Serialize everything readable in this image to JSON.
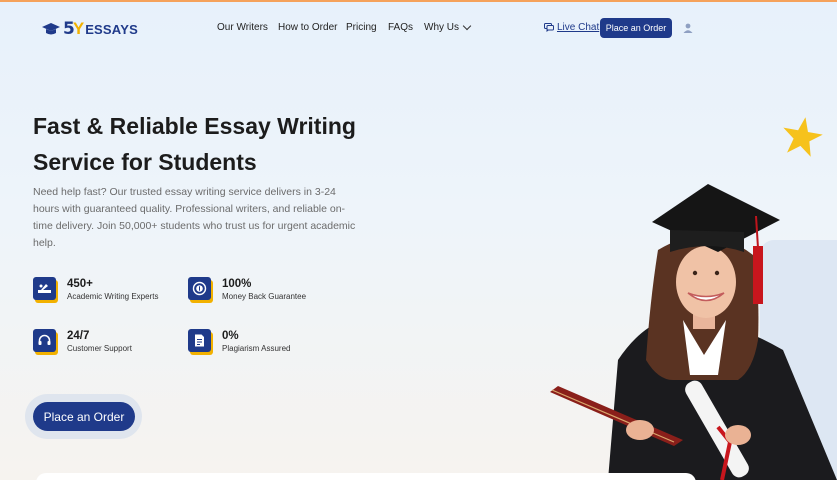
{
  "header": {
    "logo": {
      "five": "5",
      "y": "Y",
      "essays": "ESSAYS"
    },
    "nav": {
      "writers": "Our Writers",
      "how": "How to Order",
      "pricing": "Pricing",
      "faqs": "FAQs",
      "why": "Why Us"
    },
    "live_chat": "Live Chat",
    "order_button": "Place an Order"
  },
  "hero": {
    "title": "Fast & Reliable Essay Writing Service for Students",
    "description": "Need help fast? Our trusted essay writing service delivers in 3-24 hours with guaranteed quality. Professional writers, and reliable on-time delivery. Join 50,000+ students who trust us for urgent academic help.",
    "stats": [
      {
        "value": "450+",
        "label": "Academic Writing Experts",
        "icon": "writer-icon"
      },
      {
        "value": "100%",
        "label": "Money Back Guarantee",
        "icon": "money-back-icon"
      },
      {
        "value": "24/7",
        "label": "Customer Support",
        "icon": "headset-icon"
      },
      {
        "value": "0%",
        "label": "Plagiarism Assured",
        "icon": "document-check-icon"
      }
    ],
    "cta": "Place an Order"
  },
  "colors": {
    "brand": "#1f3a8a",
    "accent": "#f2b100",
    "top_line": "#f5a25b"
  }
}
